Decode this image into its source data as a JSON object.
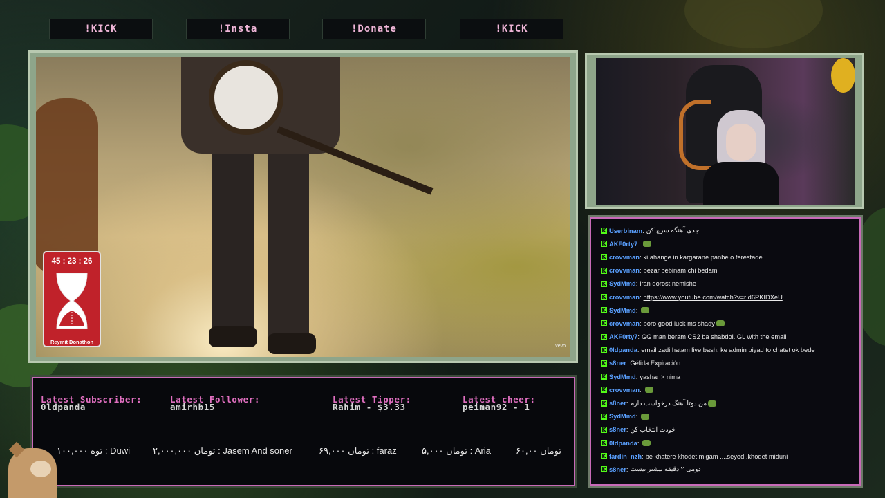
{
  "nav_buttons": [
    "!KICK",
    "!Insta",
    "!Donate",
    "!KICK"
  ],
  "video": {
    "watermark": "vevo"
  },
  "timer": {
    "time": "45 : 23 : 26",
    "label": "Reymit Donathon"
  },
  "stats": {
    "subscriber_label": "Latest Subscriber:",
    "subscriber_value": "0ldpanda",
    "follower_label": "Latest Follower:",
    "follower_value": "amirhb15",
    "tipper_label": "Latest Tipper:",
    "tipper_value": "Rahim - $3.33",
    "cheer_label": "Latest cheer:",
    "cheer_value": "peiman92 - 1"
  },
  "ticker": [
    "۱۰۰,۰۰۰ توه  :  Duwi",
    "۲,۰۰۰,۰۰۰ تومان  :  Jasem And soner",
    "۶۹,۰۰۰ تومان  :  faraz",
    "۵,۰۰۰ تومان  :  Aria",
    "۶۰,۰۰ تومان"
  ],
  "chat": [
    {
      "user": "Userbinam",
      "color": "#5aa0ff",
      "text": "جدی آهنگه سرچ کن",
      "emote": false,
      "link": false
    },
    {
      "user": "AKF0rty7",
      "color": "#5aa0ff",
      "text": "",
      "emote": true,
      "link": false
    },
    {
      "user": "crovvman",
      "color": "#5aa0ff",
      "text": "ki ahange in kargarane panbe o ferestade",
      "emote": false,
      "link": false
    },
    {
      "user": "crovvman",
      "color": "#5aa0ff",
      "text": "bezar bebinam chi bedam",
      "emote": false,
      "link": false
    },
    {
      "user": "SydMmd",
      "color": "#5aa0ff",
      "text": "iran dorost nemishe",
      "emote": false,
      "link": false
    },
    {
      "user": "crovvman",
      "color": "#5aa0ff",
      "text": "https://www.youtube.com/watch?v=rId6PKIDXeU",
      "emote": false,
      "link": true
    },
    {
      "user": "SydMmd",
      "color": "#5aa0ff",
      "text": "",
      "emote": true,
      "link": false
    },
    {
      "user": "crovvman",
      "color": "#5aa0ff",
      "text": "boro good luck ms shady",
      "emote": true,
      "link": false
    },
    {
      "user": "AKF0rty7",
      "color": "#5aa0ff",
      "text": "GG man beram CS2 ba shabdol. GL with the email",
      "emote": false,
      "link": false
    },
    {
      "user": "0ldpanda",
      "color": "#5aa0ff",
      "text": "email zadi hatam live bash, ke admin biyad to chatet ok bede",
      "emote": false,
      "link": false
    },
    {
      "user": "s8ner",
      "color": "#5aa0ff",
      "text": "Gélida Expiración",
      "emote": false,
      "link": false
    },
    {
      "user": "SydMmd",
      "color": "#5aa0ff",
      "text": "yashar > nima",
      "emote": false,
      "link": false
    },
    {
      "user": "crovvman",
      "color": "#5aa0ff",
      "text": "",
      "emote": true,
      "link": false
    },
    {
      "user": "s8ner",
      "color": "#5aa0ff",
      "text": "من دوتا آهنگ درخواست دارم",
      "emote": true,
      "link": false
    },
    {
      "user": "SydMmd",
      "color": "#5aa0ff",
      "text": "",
      "emote": true,
      "link": false
    },
    {
      "user": "s8ner",
      "color": "#5aa0ff",
      "text": "خودت انتخاب کن",
      "emote": false,
      "link": false
    },
    {
      "user": "0ldpanda",
      "color": "#5aa0ff",
      "text": "",
      "emote": true,
      "link": false
    },
    {
      "user": "fardin_nzh",
      "color": "#5aa0ff",
      "text": "be khatere khodet migam ....seyed .khodet miduni",
      "emote": false,
      "link": false
    },
    {
      "user": "s8ner",
      "color": "#5aa0ff",
      "text": "دومی ۲ دقیقه بیشتر نیست",
      "emote": false,
      "link": false
    }
  ],
  "colors": {
    "accent": "#c86ab8",
    "kick_green": "#53fc18",
    "frame": "#b8c9b0"
  }
}
